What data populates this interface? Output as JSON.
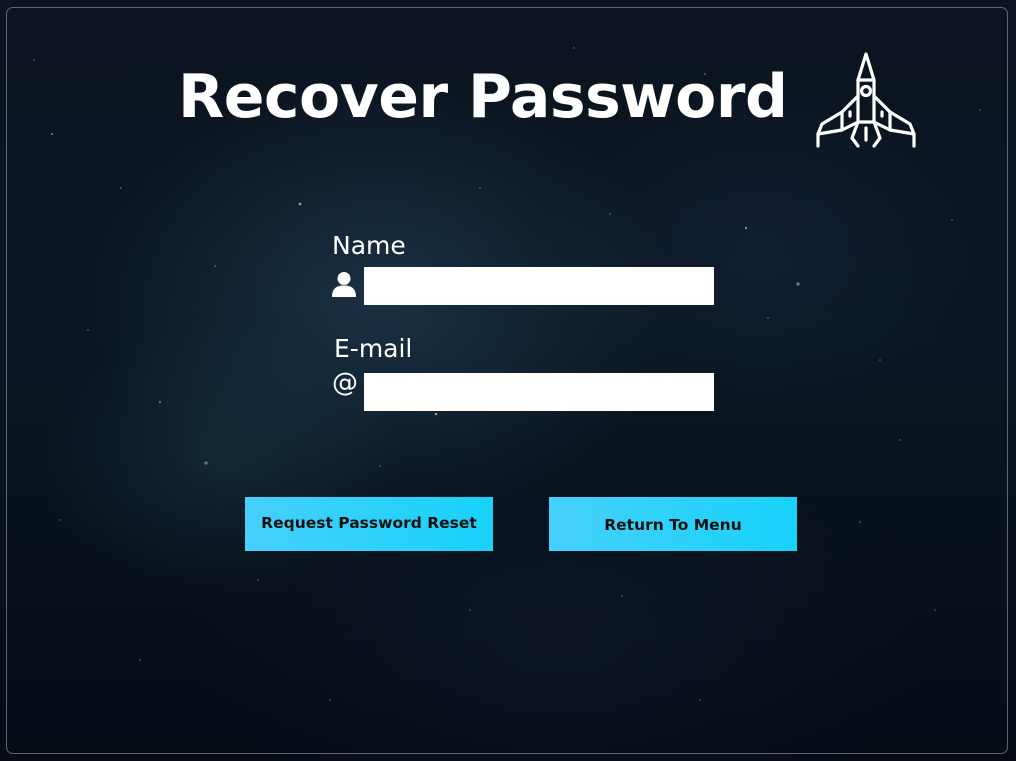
{
  "page": {
    "title": "Recover Password",
    "logo_icon": "rocket-icon",
    "accent_color": "#1fd2fa"
  },
  "form": {
    "name": {
      "label": "Name",
      "icon": "user-icon",
      "value": ""
    },
    "email": {
      "label": "E-mail",
      "icon": "at-sign-icon",
      "icon_glyph": "@",
      "value": ""
    }
  },
  "buttons": {
    "reset_label": "Request Password Reset",
    "menu_label": "Return To Menu"
  }
}
